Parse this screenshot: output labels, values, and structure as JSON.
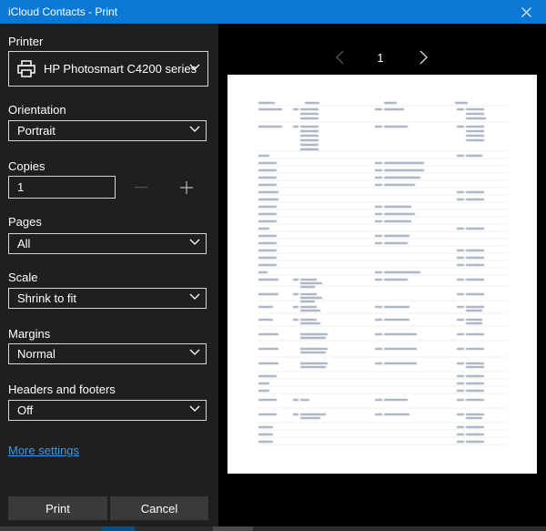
{
  "window": {
    "title": "iCloud Contacts - Print"
  },
  "printer": {
    "label": "Printer",
    "value": "HP Photosmart C4200 series"
  },
  "orientation": {
    "label": "Orientation",
    "value": "Portrait"
  },
  "copies": {
    "label": "Copies",
    "value": "1"
  },
  "pages": {
    "label": "Pages",
    "value": "All"
  },
  "scale": {
    "label": "Scale",
    "value": "Shrink to fit"
  },
  "margins": {
    "label": "Margins",
    "value": "Normal"
  },
  "headers": {
    "label": "Headers and footers",
    "value": "Off"
  },
  "more_settings": "More settings",
  "buttons": {
    "print": "Print",
    "cancel": "Cancel"
  },
  "preview": {
    "page": "1"
  },
  "colors": {
    "titlebar": "#0a78d4",
    "panel": "#1f1f1f",
    "preview_bg": "#000000",
    "link": "#3a9bef",
    "button": "#3a3a3a"
  }
}
